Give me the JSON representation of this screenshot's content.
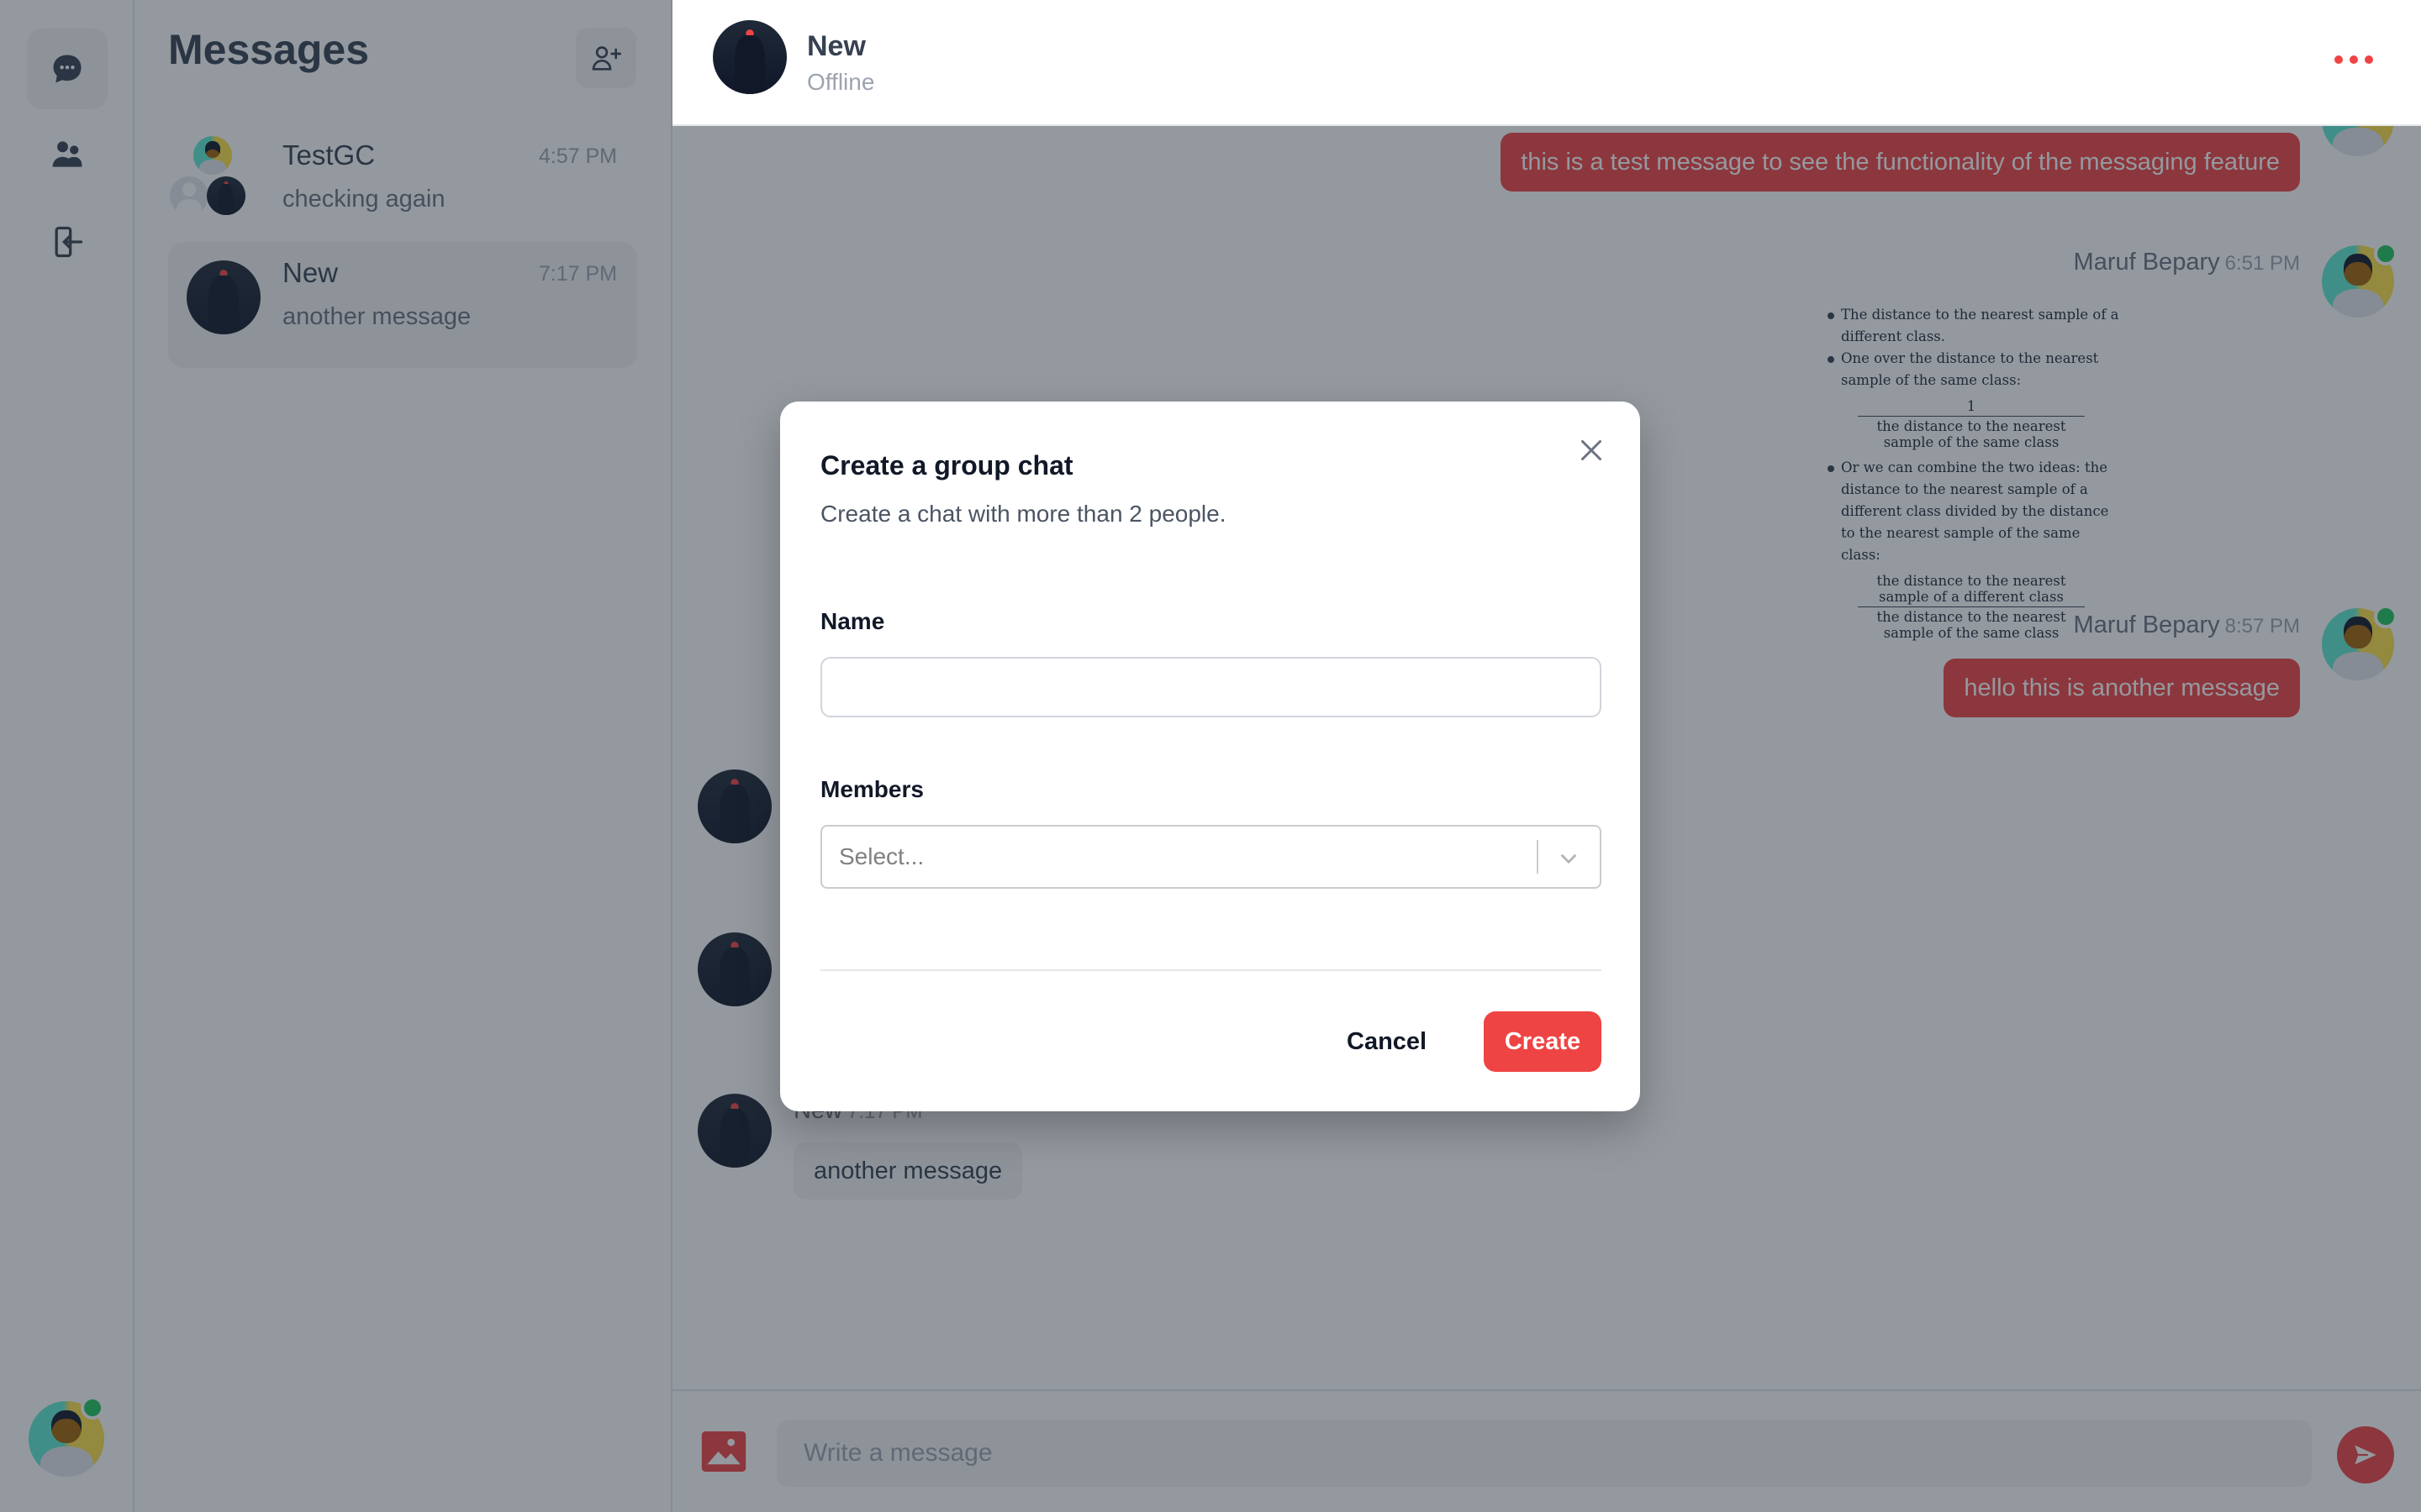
{
  "rail": {
    "items": [
      {
        "icon": "chat-bubble-icon",
        "active": true
      },
      {
        "icon": "users-icon",
        "active": false
      },
      {
        "icon": "logout-icon",
        "active": false
      }
    ],
    "current_user": {
      "name": "Maruf Bepary",
      "online": true
    }
  },
  "conversations": {
    "title": "Messages",
    "new_group_icon": "user-plus-icon",
    "items": [
      {
        "name": "TestGC",
        "time": "4:57 PM",
        "preview": "checking again",
        "type": "group",
        "active": false
      },
      {
        "name": "New",
        "time": "7:17 PM",
        "preview": "another message",
        "type": "direct",
        "active": true
      }
    ]
  },
  "chat": {
    "header": {
      "name": "New",
      "status": "Offline",
      "more_icon": "ellipsis-icon"
    },
    "messages": [
      {
        "direction": "out",
        "text": "this is a test message to see the functionality of the messaging feature"
      },
      {
        "direction": "out",
        "sender": "Maruf Bepary",
        "time": "6:51 PM",
        "type": "image",
        "image_text": {
          "bullet1": "The distance to the nearest sample of a different class.",
          "bullet2": "One over the distance to the nearest sample of the same class:",
          "frac1_num": "1",
          "frac1_den": "the distance to the nearest sample of the same class",
          "bullet3": "Or we can combine the two ideas: the distance to the nearest sample of a different class divided by the distance to the nearest sample of the same class:",
          "frac2_num": "the distance to the nearest sample of a different class",
          "frac2_den": "the distance to the nearest sample of the same class"
        }
      },
      {
        "direction": "out",
        "sender": "Maruf Bepary",
        "time": "8:57 PM",
        "text": "hello this is another message"
      },
      {
        "direction": "in",
        "sender": "New",
        "time": "7:17 PM",
        "text": "another message"
      }
    ],
    "composer": {
      "placeholder": "Write a message",
      "image_icon": "image-icon",
      "send_icon": "send-icon"
    }
  },
  "modal": {
    "title": "Create a group chat",
    "description": "Create a chat with more than 2 people.",
    "name_label": "Name",
    "name_value": "",
    "members_label": "Members",
    "members_placeholder": "Select...",
    "cancel_label": "Cancel",
    "create_label": "Create"
  },
  "colors": {
    "accent": "#ef4444",
    "online": "#22c55e",
    "overlay": "#1f2937"
  }
}
